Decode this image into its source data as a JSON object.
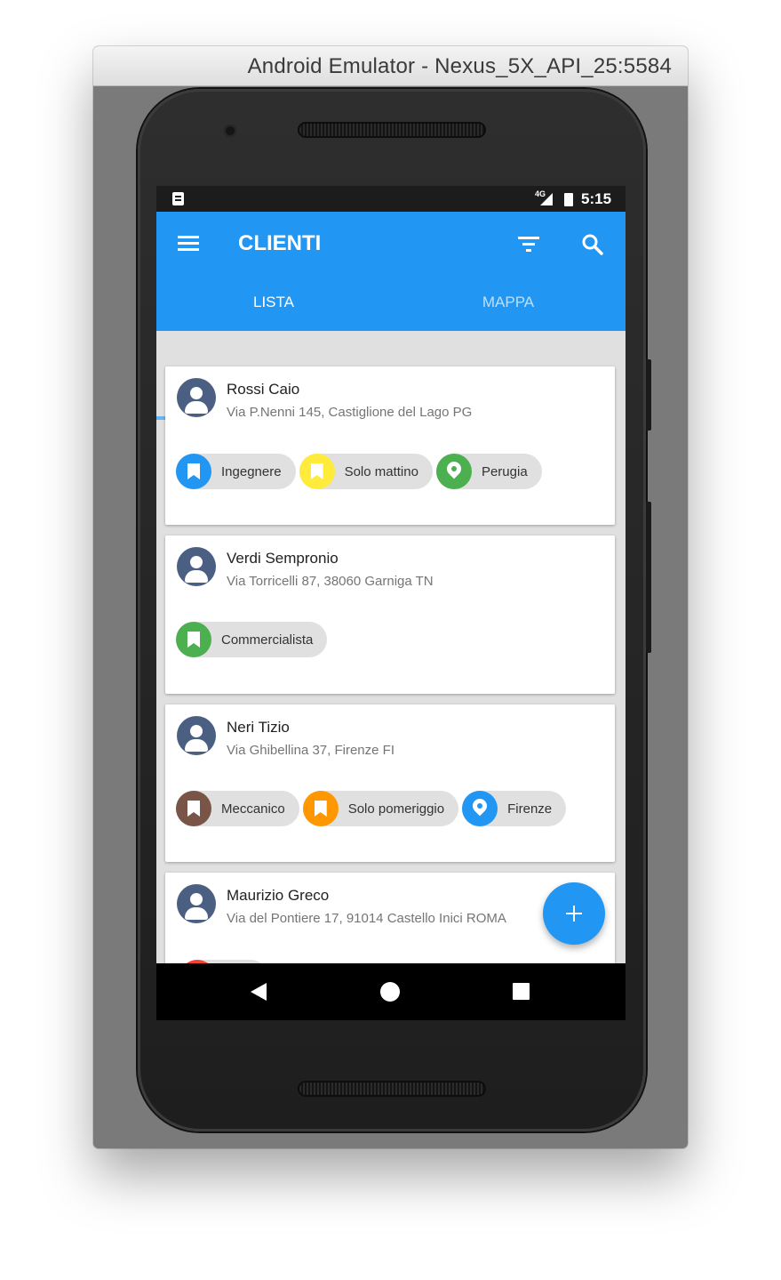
{
  "window": {
    "title": "Android Emulator - Nexus_5X_API_25:5584"
  },
  "status_bar": {
    "network": "4G",
    "time": "5:15"
  },
  "app_bar": {
    "title": "CLIENTI",
    "menu_icon": "menu-icon",
    "filter_icon": "filter-icon",
    "search_icon": "search-icon"
  },
  "tabs": [
    {
      "label": "LISTA",
      "active": true
    },
    {
      "label": "MAPPA",
      "active": false
    }
  ],
  "colors": {
    "primary": "#2196f3",
    "blue": "#2196f3",
    "yellow": "#ffeb3b",
    "green": "#4caf50",
    "brown": "#795548",
    "orange": "#ff9800",
    "avatar": "#4a5f82"
  },
  "clients": [
    {
      "name": "Rossi Caio",
      "address": "Via P.Nenni 145, Castiglione del Lago PG",
      "tags": [
        {
          "label": "Ingegnere",
          "icon": "bookmark-icon",
          "color": "#2196f3"
        },
        {
          "label": "Solo mattino",
          "icon": "bookmark-icon",
          "color": "#ffeb3b"
        },
        {
          "label": "Perugia",
          "icon": "location-pin-icon",
          "color": "#4caf50"
        }
      ]
    },
    {
      "name": "Verdi Sempronio",
      "address": "Via Torricelli 87, 38060 Garniga TN",
      "tags": [
        {
          "label": "Commercialista",
          "icon": "bookmark-icon",
          "color": "#4caf50"
        }
      ]
    },
    {
      "name": "Neri Tizio",
      "address": "Via Ghibellina 37, Firenze FI",
      "tags": [
        {
          "label": "Meccanico",
          "icon": "bookmark-icon",
          "color": "#795548"
        },
        {
          "label": "Solo pomeriggio",
          "icon": "bookmark-icon",
          "color": "#ff9800"
        },
        {
          "label": "Firenze",
          "icon": "location-pin-icon",
          "color": "#2196f3"
        }
      ]
    },
    {
      "name": "Maurizio Greco",
      "address": "Via del Pontiere 17, 91014 Castello Inici ROMA",
      "tags": []
    }
  ],
  "fab": {
    "icon": "plus-icon"
  },
  "nav_bar": {
    "back_icon": "back-icon",
    "home_icon": "home-icon",
    "recents_icon": "recents-icon"
  }
}
